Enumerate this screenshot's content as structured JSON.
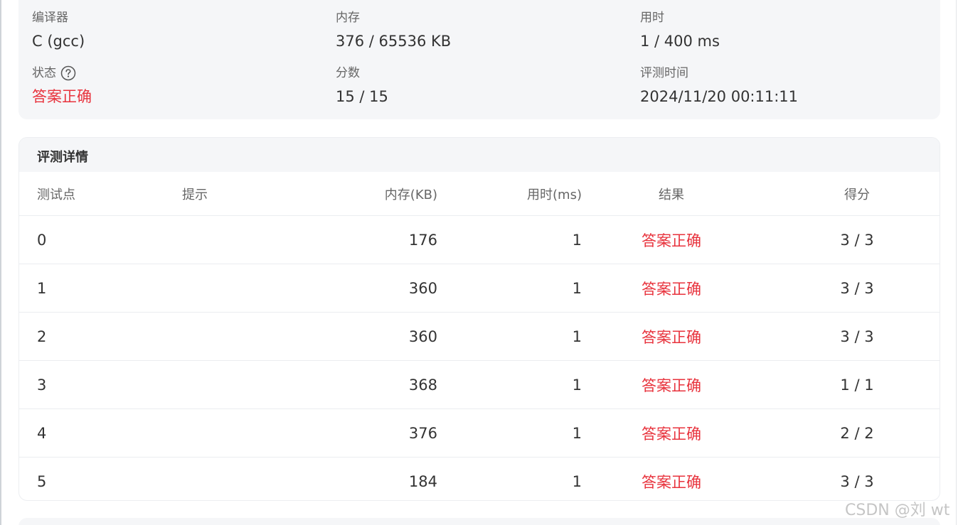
{
  "summary": {
    "compiler": {
      "label": "编译器",
      "value": "C (gcc)"
    },
    "memory": {
      "label": "内存",
      "value": "376 / 65536 KB"
    },
    "time": {
      "label": "用时",
      "value": "1 / 400 ms"
    },
    "status": {
      "label": "状态",
      "value": "答案正确"
    },
    "score": {
      "label": "分数",
      "value": "15 / 15"
    },
    "judge_time": {
      "label": "评测时间",
      "value": "2024/11/20 00:11:11"
    }
  },
  "details": {
    "title": "评测详情",
    "columns": {
      "testcase": "测试点",
      "hint": "提示",
      "memory": "内存(KB)",
      "time": "用时(ms)",
      "result": "结果",
      "score": "得分"
    },
    "rows": [
      {
        "id": "0",
        "memory": "176",
        "time": "1",
        "result": "答案正确",
        "score": "3 / 3"
      },
      {
        "id": "1",
        "memory": "360",
        "time": "1",
        "result": "答案正确",
        "score": "3 / 3"
      },
      {
        "id": "2",
        "memory": "360",
        "time": "1",
        "result": "答案正确",
        "score": "3 / 3"
      },
      {
        "id": "3",
        "memory": "368",
        "time": "1",
        "result": "答案正确",
        "score": "1 / 1"
      },
      {
        "id": "4",
        "memory": "376",
        "time": "1",
        "result": "答案正确",
        "score": "2 / 2"
      },
      {
        "id": "5",
        "memory": "184",
        "time": "1",
        "result": "答案正确",
        "score": "3 / 3"
      }
    ]
  },
  "watermark": "CSDN @刘 wt",
  "colors": {
    "accent_red": "#e8333d",
    "card_bg": "#f5f6f8"
  }
}
